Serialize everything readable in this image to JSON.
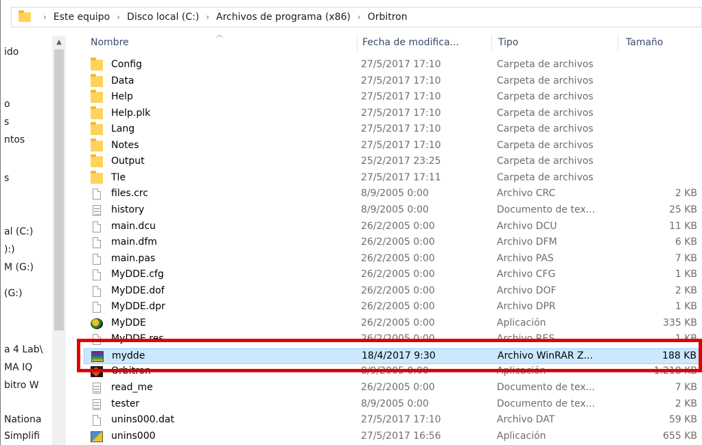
{
  "breadcrumb": {
    "items": [
      "Este equipo",
      "Disco local (C:)",
      "Archivos de programa (x86)",
      "Orbitron"
    ],
    "separator": "›"
  },
  "nav": {
    "items": [
      "ido",
      "o",
      "s",
      "ntos",
      "",
      "s",
      "al (C:)",
      "):)",
      "M (G:)",
      "(G:)",
      "a 4 Lab\\",
      "MA IQ",
      "bitro W",
      "Nationa",
      "Simplifi"
    ]
  },
  "columns": {
    "name": "Nombre",
    "date": "Fecha de modifica...",
    "type": "Tipo",
    "size": "Tamaño"
  },
  "files": [
    {
      "name": "Config",
      "date": "27/5/2017 17:10",
      "type": "Carpeta de archivos",
      "size": "",
      "icon": "folder-icon"
    },
    {
      "name": "Data",
      "date": "27/5/2017 17:10",
      "type": "Carpeta de archivos",
      "size": "",
      "icon": "folder-icon"
    },
    {
      "name": "Help",
      "date": "27/5/2017 17:10",
      "type": "Carpeta de archivos",
      "size": "",
      "icon": "folder-icon"
    },
    {
      "name": "Help.plk",
      "date": "27/5/2017 17:10",
      "type": "Carpeta de archivos",
      "size": "",
      "icon": "folder-icon"
    },
    {
      "name": "Lang",
      "date": "27/5/2017 17:10",
      "type": "Carpeta de archivos",
      "size": "",
      "icon": "folder-icon"
    },
    {
      "name": "Notes",
      "date": "27/5/2017 17:10",
      "type": "Carpeta de archivos",
      "size": "",
      "icon": "folder-icon"
    },
    {
      "name": "Output",
      "date": "25/2/2017 23:25",
      "type": "Carpeta de archivos",
      "size": "",
      "icon": "folder-icon"
    },
    {
      "name": "Tle",
      "date": "27/5/2017 17:11",
      "type": "Carpeta de archivos",
      "size": "",
      "icon": "folder-icon"
    },
    {
      "name": "files.crc",
      "date": "8/9/2005 0:00",
      "type": "Archivo CRC",
      "size": "2 KB",
      "icon": "file-icon"
    },
    {
      "name": "history",
      "date": "8/9/2005 0:00",
      "type": "Documento de tex...",
      "size": "25 KB",
      "icon": "text-document-icon"
    },
    {
      "name": "main.dcu",
      "date": "26/2/2005 0:00",
      "type": "Archivo DCU",
      "size": "11 KB",
      "icon": "file-icon"
    },
    {
      "name": "main.dfm",
      "date": "26/2/2005 0:00",
      "type": "Archivo DFM",
      "size": "6 KB",
      "icon": "file-icon"
    },
    {
      "name": "main.pas",
      "date": "26/2/2005 0:00",
      "type": "Archivo PAS",
      "size": "7 KB",
      "icon": "file-icon"
    },
    {
      "name": "MyDDE.cfg",
      "date": "26/2/2005 0:00",
      "type": "Archivo CFG",
      "size": "1 KB",
      "icon": "file-icon"
    },
    {
      "name": "MyDDE.dof",
      "date": "26/2/2005 0:00",
      "type": "Archivo DOF",
      "size": "2 KB",
      "icon": "file-icon"
    },
    {
      "name": "MyDDE.dpr",
      "date": "26/2/2005 0:00",
      "type": "Archivo DPR",
      "size": "1 KB",
      "icon": "file-icon"
    },
    {
      "name": "MyDDE",
      "date": "26/2/2005 0:00",
      "type": "Aplicación",
      "size": "335 KB",
      "icon": "application-icon"
    },
    {
      "name": "MyDDE.res",
      "date": "26/2/2005 0:00",
      "type": "Archivo RES",
      "size": "1 KB",
      "icon": "file-icon"
    },
    {
      "name": "mydde",
      "date": "18/4/2017 9:30",
      "type": "Archivo WinRAR Z...",
      "size": "188 KB",
      "icon": "winrar-archive-icon",
      "selected": true
    },
    {
      "name": "Orbitron",
      "date": "8/9/2005 0:00",
      "type": "Aplicación",
      "size": "1.218 KB",
      "icon": "orbitron-app-icon"
    },
    {
      "name": "read_me",
      "date": "26/2/2005 0:00",
      "type": "Documento de tex...",
      "size": "7 KB",
      "icon": "text-document-icon"
    },
    {
      "name": "tester",
      "date": "8/9/2005 0:00",
      "type": "Documento de tex...",
      "size": "2 KB",
      "icon": "text-document-icon"
    },
    {
      "name": "unins000.dat",
      "date": "27/5/2017 17:10",
      "type": "Archivo DAT",
      "size": "59 KB",
      "icon": "file-icon"
    },
    {
      "name": "unins000",
      "date": "27/5/2017 16:56",
      "type": "Aplicación",
      "size": "655 KB",
      "icon": "installer-icon"
    }
  ],
  "colors": {
    "selection_bg": "#cce8ff",
    "highlight_border": "#e00000",
    "folder": "#ffd35b"
  }
}
